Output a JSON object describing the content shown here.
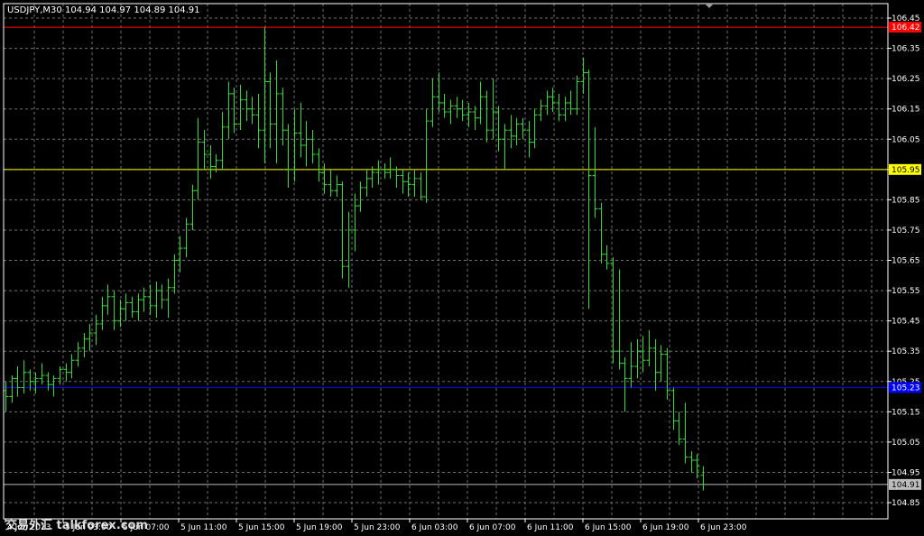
{
  "header": {
    "symbol": "USDJPY,M30",
    "ohlc": "104.94 104.97 104.89 104.91"
  },
  "watermark": "交易外汇 talkforex.com",
  "colors": {
    "background": "#000000",
    "frame": "#ffffff",
    "grid": "#6f6f6f",
    "bars": "#28e028",
    "line_red": "#ff0000",
    "line_yellow": "#ffff00",
    "line_blue": "#0000ff",
    "line_gray": "#bdbdbd"
  },
  "chart_data": {
    "type": "ohlc",
    "title": "USDJPY,M30",
    "ylim": [
      104.8,
      106.5
    ],
    "y_ticks": [
      "106.45",
      "106.35",
      "106.25",
      "106.15",
      "106.05",
      "105.95",
      "105.85",
      "105.75",
      "105.65",
      "105.55",
      "105.45",
      "105.35",
      "105.25",
      "105.15",
      "105.05",
      "104.95",
      "104.85"
    ],
    "x_ticks": [
      "4 Jun 2013",
      "5 Jun 03:00",
      "5 Jun 07:00",
      "5 Jun 11:00",
      "5 Jun 15:00",
      "5 Jun 19:00",
      "5 Jun 23:00",
      "6 Jun 03:00",
      "6 Jun 07:00",
      "6 Jun 11:00",
      "6 Jun 15:00",
      "6 Jun 19:00",
      "6 Jun 23:00"
    ],
    "grid": true,
    "horizontal_lines": [
      {
        "price": 106.42,
        "label": "106.42",
        "color": "#ff0000"
      },
      {
        "price": 105.95,
        "label": "105.95",
        "color": "#ffff00"
      },
      {
        "price": 105.23,
        "label": "105.23",
        "color": "#0000ff"
      },
      {
        "price": 104.91,
        "label": "104.91",
        "color": "#bdbdbd"
      }
    ],
    "bars": [
      {
        "o": 105.22,
        "h": 105.25,
        "l": 105.15,
        "c": 105.2
      },
      {
        "o": 105.2,
        "h": 105.27,
        "l": 105.18,
        "c": 105.26
      },
      {
        "o": 105.26,
        "h": 105.3,
        "l": 105.2,
        "c": 105.23
      },
      {
        "o": 105.23,
        "h": 105.32,
        "l": 105.21,
        "c": 105.28
      },
      {
        "o": 105.28,
        "h": 105.29,
        "l": 105.22,
        "c": 105.25
      },
      {
        "o": 105.25,
        "h": 105.28,
        "l": 105.21,
        "c": 105.26
      },
      {
        "o": 105.26,
        "h": 105.31,
        "l": 105.24,
        "c": 105.27
      },
      {
        "o": 105.27,
        "h": 105.28,
        "l": 105.22,
        "c": 105.24
      },
      {
        "o": 105.24,
        "h": 105.27,
        "l": 105.2,
        "c": 105.26
      },
      {
        "o": 105.26,
        "h": 105.3,
        "l": 105.24,
        "c": 105.29
      },
      {
        "o": 105.29,
        "h": 105.31,
        "l": 105.25,
        "c": 105.28
      },
      {
        "o": 105.28,
        "h": 105.34,
        "l": 105.26,
        "c": 105.32
      },
      {
        "o": 105.32,
        "h": 105.38,
        "l": 105.3,
        "c": 105.36
      },
      {
        "o": 105.36,
        "h": 105.41,
        "l": 105.33,
        "c": 105.39
      },
      {
        "o": 105.39,
        "h": 105.44,
        "l": 105.35,
        "c": 105.41
      },
      {
        "o": 105.41,
        "h": 105.47,
        "l": 105.37,
        "c": 105.44
      },
      {
        "o": 105.44,
        "h": 105.53,
        "l": 105.42,
        "c": 105.5
      },
      {
        "o": 105.5,
        "h": 105.57,
        "l": 105.47,
        "c": 105.53
      },
      {
        "o": 105.53,
        "h": 105.55,
        "l": 105.42,
        "c": 105.45
      },
      {
        "o": 105.45,
        "h": 105.52,
        "l": 105.43,
        "c": 105.49
      },
      {
        "o": 105.49,
        "h": 105.54,
        "l": 105.45,
        "c": 105.51
      },
      {
        "o": 105.51,
        "h": 105.53,
        "l": 105.46,
        "c": 105.48
      },
      {
        "o": 105.48,
        "h": 105.54,
        "l": 105.45,
        "c": 105.52
      },
      {
        "o": 105.52,
        "h": 105.56,
        "l": 105.48,
        "c": 105.53
      },
      {
        "o": 105.53,
        "h": 105.57,
        "l": 105.47,
        "c": 105.5
      },
      {
        "o": 105.5,
        "h": 105.58,
        "l": 105.46,
        "c": 105.55
      },
      {
        "o": 105.55,
        "h": 105.57,
        "l": 105.49,
        "c": 105.52
      },
      {
        "o": 105.52,
        "h": 105.59,
        "l": 105.46,
        "c": 105.56
      },
      {
        "o": 105.56,
        "h": 105.67,
        "l": 105.54,
        "c": 105.65
      },
      {
        "o": 105.65,
        "h": 105.73,
        "l": 105.61,
        "c": 105.69
      },
      {
        "o": 105.69,
        "h": 105.79,
        "l": 105.66,
        "c": 105.77
      },
      {
        "o": 105.77,
        "h": 105.9,
        "l": 105.75,
        "c": 105.88
      },
      {
        "o": 105.88,
        "h": 106.12,
        "l": 105.85,
        "c": 106.04
      },
      {
        "o": 106.04,
        "h": 106.08,
        "l": 105.95,
        "c": 106.0
      },
      {
        "o": 106.0,
        "h": 106.03,
        "l": 105.92,
        "c": 105.96
      },
      {
        "o": 105.96,
        "h": 106.0,
        "l": 105.94,
        "c": 105.98
      },
      {
        "o": 105.98,
        "h": 106.14,
        "l": 105.95,
        "c": 106.09
      },
      {
        "o": 106.09,
        "h": 106.24,
        "l": 106.05,
        "c": 106.2
      },
      {
        "o": 106.2,
        "h": 106.22,
        "l": 106.07,
        "c": 106.1
      },
      {
        "o": 106.1,
        "h": 106.23,
        "l": 106.08,
        "c": 106.18
      },
      {
        "o": 106.18,
        "h": 106.21,
        "l": 106.11,
        "c": 106.15
      },
      {
        "o": 106.15,
        "h": 106.19,
        "l": 106.1,
        "c": 106.13
      },
      {
        "o": 106.13,
        "h": 106.2,
        "l": 106.02,
        "c": 106.08
      },
      {
        "o": 106.08,
        "h": 106.42,
        "l": 105.97,
        "c": 106.24
      },
      {
        "o": 106.24,
        "h": 106.27,
        "l": 106.02,
        "c": 106.1
      },
      {
        "o": 106.1,
        "h": 106.31,
        "l": 105.97,
        "c": 106.2
      },
      {
        "o": 106.2,
        "h": 106.22,
        "l": 106.03,
        "c": 106.08
      },
      {
        "o": 106.08,
        "h": 106.1,
        "l": 105.89,
        "c": 105.95
      },
      {
        "o": 105.95,
        "h": 106.15,
        "l": 105.91,
        "c": 106.07
      },
      {
        "o": 106.07,
        "h": 106.17,
        "l": 105.99,
        "c": 106.03
      },
      {
        "o": 106.03,
        "h": 106.11,
        "l": 105.96,
        "c": 106.05
      },
      {
        "o": 106.05,
        "h": 106.08,
        "l": 105.97,
        "c": 106.0
      },
      {
        "o": 106.0,
        "h": 106.02,
        "l": 105.91,
        "c": 105.94
      },
      {
        "o": 105.94,
        "h": 105.97,
        "l": 105.87,
        "c": 105.9
      },
      {
        "o": 105.9,
        "h": 105.95,
        "l": 105.86,
        "c": 105.88
      },
      {
        "o": 105.88,
        "h": 105.93,
        "l": 105.86,
        "c": 105.9
      },
      {
        "o": 105.9,
        "h": 105.91,
        "l": 105.59,
        "c": 105.63
      },
      {
        "o": 105.63,
        "h": 105.81,
        "l": 105.56,
        "c": 105.75
      },
      {
        "o": 105.75,
        "h": 105.87,
        "l": 105.68,
        "c": 105.83
      },
      {
        "o": 105.83,
        "h": 105.91,
        "l": 105.81,
        "c": 105.89
      },
      {
        "o": 105.89,
        "h": 105.95,
        "l": 105.86,
        "c": 105.92
      },
      {
        "o": 105.92,
        "h": 105.96,
        "l": 105.89,
        "c": 105.94
      },
      {
        "o": 105.94,
        "h": 105.98,
        "l": 105.9,
        "c": 105.95
      },
      {
        "o": 105.95,
        "h": 105.97,
        "l": 105.92,
        "c": 105.94
      },
      {
        "o": 105.94,
        "h": 105.99,
        "l": 105.92,
        "c": 105.95
      },
      {
        "o": 105.95,
        "h": 105.96,
        "l": 105.89,
        "c": 105.93
      },
      {
        "o": 105.93,
        "h": 105.95,
        "l": 105.87,
        "c": 105.91
      },
      {
        "o": 105.91,
        "h": 105.94,
        "l": 105.86,
        "c": 105.9
      },
      {
        "o": 105.9,
        "h": 105.95,
        "l": 105.86,
        "c": 105.92
      },
      {
        "o": 105.92,
        "h": 105.94,
        "l": 105.85,
        "c": 105.86
      },
      {
        "o": 105.86,
        "h": 106.15,
        "l": 105.84,
        "c": 106.11
      },
      {
        "o": 106.11,
        "h": 106.25,
        "l": 106.09,
        "c": 106.19
      },
      {
        "o": 106.19,
        "h": 106.27,
        "l": 106.14,
        "c": 106.17
      },
      {
        "o": 106.17,
        "h": 106.2,
        "l": 106.12,
        "c": 106.14
      },
      {
        "o": 106.14,
        "h": 106.18,
        "l": 106.1,
        "c": 106.16
      },
      {
        "o": 106.16,
        "h": 106.19,
        "l": 106.12,
        "c": 106.15
      },
      {
        "o": 106.15,
        "h": 106.18,
        "l": 106.11,
        "c": 106.13
      },
      {
        "o": 106.13,
        "h": 106.17,
        "l": 106.09,
        "c": 106.14
      },
      {
        "o": 106.14,
        "h": 106.16,
        "l": 106.08,
        "c": 106.12
      },
      {
        "o": 106.12,
        "h": 106.24,
        "l": 106.1,
        "c": 106.19
      },
      {
        "o": 106.19,
        "h": 106.21,
        "l": 106.04,
        "c": 106.08
      },
      {
        "o": 106.08,
        "h": 106.25,
        "l": 106.05,
        "c": 106.14
      },
      {
        "o": 106.14,
        "h": 106.16,
        "l": 106.01,
        "c": 106.05
      },
      {
        "o": 106.05,
        "h": 106.1,
        "l": 105.95,
        "c": 106.08
      },
      {
        "o": 106.08,
        "h": 106.13,
        "l": 106.02,
        "c": 106.06
      },
      {
        "o": 106.06,
        "h": 106.12,
        "l": 106.03,
        "c": 106.1
      },
      {
        "o": 106.1,
        "h": 106.12,
        "l": 106.05,
        "c": 106.08
      },
      {
        "o": 106.08,
        "h": 106.11,
        "l": 105.99,
        "c": 106.04
      },
      {
        "o": 106.04,
        "h": 106.15,
        "l": 106.02,
        "c": 106.13
      },
      {
        "o": 106.13,
        "h": 106.18,
        "l": 106.11,
        "c": 106.16
      },
      {
        "o": 106.16,
        "h": 106.21,
        "l": 106.13,
        "c": 106.19
      },
      {
        "o": 106.19,
        "h": 106.22,
        "l": 106.14,
        "c": 106.17
      },
      {
        "o": 106.17,
        "h": 106.2,
        "l": 106.11,
        "c": 106.13
      },
      {
        "o": 106.13,
        "h": 106.19,
        "l": 106.11,
        "c": 106.17
      },
      {
        "o": 106.17,
        "h": 106.21,
        "l": 106.13,
        "c": 106.15
      },
      {
        "o": 106.15,
        "h": 106.26,
        "l": 106.13,
        "c": 106.24
      },
      {
        "o": 106.24,
        "h": 106.32,
        "l": 106.2,
        "c": 106.27
      },
      {
        "o": 106.27,
        "h": 106.28,
        "l": 105.49,
        "c": 105.93
      },
      {
        "o": 105.93,
        "h": 106.09,
        "l": 105.79,
        "c": 105.82
      },
      {
        "o": 105.82,
        "h": 105.84,
        "l": 105.64,
        "c": 105.67
      },
      {
        "o": 105.67,
        "h": 105.7,
        "l": 105.62,
        "c": 105.64
      },
      {
        "o": 105.64,
        "h": 105.66,
        "l": 105.31,
        "c": 105.35
      },
      {
        "o": 105.35,
        "h": 105.62,
        "l": 105.29,
        "c": 105.31
      },
      {
        "o": 105.31,
        "h": 105.33,
        "l": 105.15,
        "c": 105.26
      },
      {
        "o": 105.26,
        "h": 105.38,
        "l": 105.23,
        "c": 105.3
      },
      {
        "o": 105.3,
        "h": 105.39,
        "l": 105.26,
        "c": 105.35
      },
      {
        "o": 105.35,
        "h": 105.4,
        "l": 105.28,
        "c": 105.32
      },
      {
        "o": 105.32,
        "h": 105.42,
        "l": 105.3,
        "c": 105.36
      },
      {
        "o": 105.36,
        "h": 105.39,
        "l": 105.22,
        "c": 105.28
      },
      {
        "o": 105.28,
        "h": 105.37,
        "l": 105.25,
        "c": 105.34
      },
      {
        "o": 105.34,
        "h": 105.36,
        "l": 105.19,
        "c": 105.22
      },
      {
        "o": 105.22,
        "h": 105.23,
        "l": 105.09,
        "c": 105.12
      },
      {
        "o": 105.12,
        "h": 105.15,
        "l": 105.04,
        "c": 105.06
      },
      {
        "o": 105.06,
        "h": 105.18,
        "l": 104.98,
        "c": 105.0
      },
      {
        "o": 105.0,
        "h": 105.02,
        "l": 104.95,
        "c": 104.99
      },
      {
        "o": 104.99,
        "h": 105.01,
        "l": 104.93,
        "c": 104.97
      },
      {
        "o": 104.94,
        "h": 104.97,
        "l": 104.89,
        "c": 104.91
      }
    ]
  }
}
